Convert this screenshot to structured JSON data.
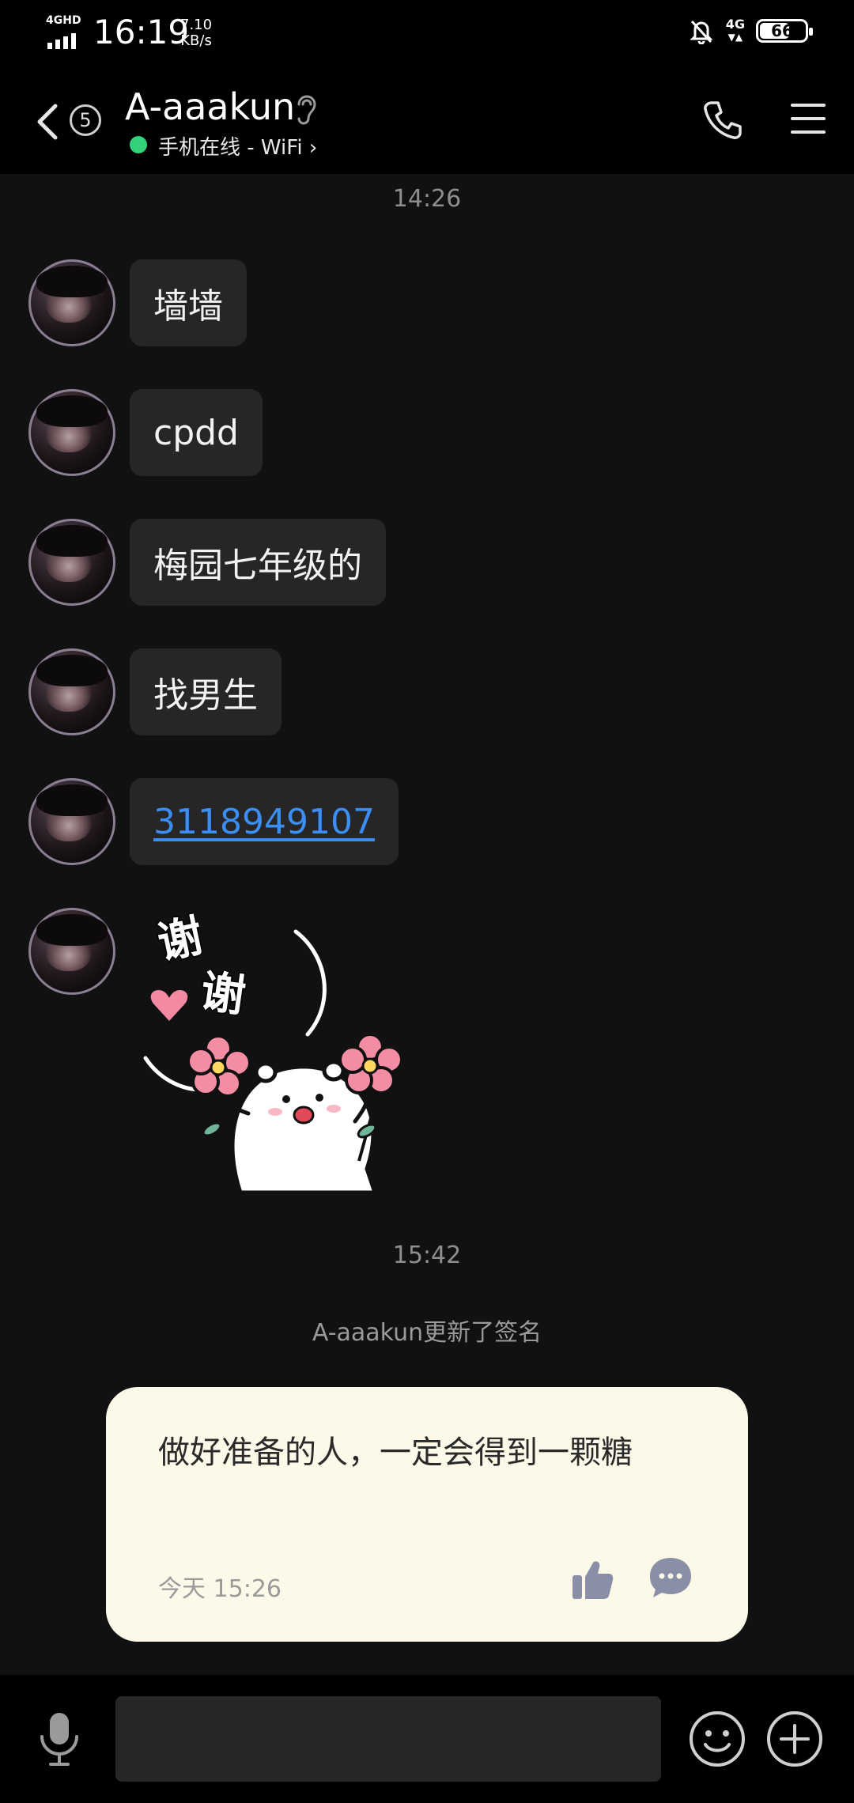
{
  "status_bar": {
    "network_label": "4GHD",
    "time": "16:19",
    "speed_value": "7.10",
    "speed_unit": "KB/s",
    "network_right": "4G",
    "battery": "66"
  },
  "header": {
    "unread_count": "5",
    "contact_name": "A-aaakun",
    "online_status": "手机在线 - WiFi",
    "online_color": "#33d17a",
    "icons": [
      "back-icon",
      "ear-icon",
      "phone-icon",
      "menu-icon"
    ]
  },
  "chat": {
    "time_1": "14:26",
    "messages": [
      {
        "type": "text",
        "text": "墙墙"
      },
      {
        "type": "text",
        "text": "cpdd"
      },
      {
        "type": "text",
        "text": "梅园七年级的"
      },
      {
        "type": "text",
        "text": "找男生"
      },
      {
        "type": "link",
        "text": "3118949107"
      },
      {
        "type": "sticker",
        "text": "谢谢"
      }
    ],
    "time_2": "15:42",
    "notice": "A-aaakun更新了签名",
    "signature": {
      "text": "做好准备的人，一定会得到一颗糖",
      "date": "今天 15:26"
    }
  },
  "input_bar": {
    "placeholder": "",
    "icons": [
      "mic-icon",
      "emoji-icon",
      "plus-icon"
    ]
  },
  "colors": {
    "background": "#111111",
    "bubble": "#262626",
    "link": "#3b8ef5",
    "signature_card": "#fcf9e8"
  }
}
